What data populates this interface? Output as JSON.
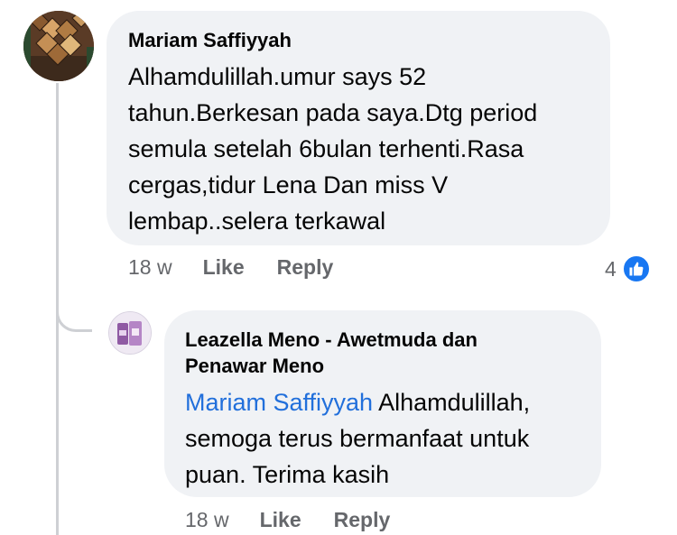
{
  "comment": {
    "author": "Mariam Saffiyyah",
    "text_lines": [
      "Alhamdulillah.umur says 52",
      "tahun.Berkesan pada saya.Dtg period",
      "semula setelah 6bulan terhenti.Rasa",
      "cergas,tidur Lena Dan miss V",
      "lembap..selera terkawal"
    ],
    "time": "18 w",
    "like_label": "Like",
    "reply_label": "Reply",
    "reaction_count": "4",
    "reaction_icon": "thumbs-up-icon"
  },
  "reply": {
    "author_lines": [
      "Leazella Meno - Awetmuda dan",
      "Penawar Meno"
    ],
    "mention": "Mariam Saffiyyah",
    "text_first_rest": " Alhamdulillah,",
    "text_lines": [
      "semoga terus bermanfaat untuk",
      "puan. Terima kasih"
    ],
    "time": "18 w",
    "like_label": "Like",
    "reply_label": "Reply"
  },
  "colors": {
    "bubble": "#f0f2f5",
    "mention": "#216fdb",
    "secondary_text": "#65676b",
    "like_badge": "#1877f2"
  }
}
